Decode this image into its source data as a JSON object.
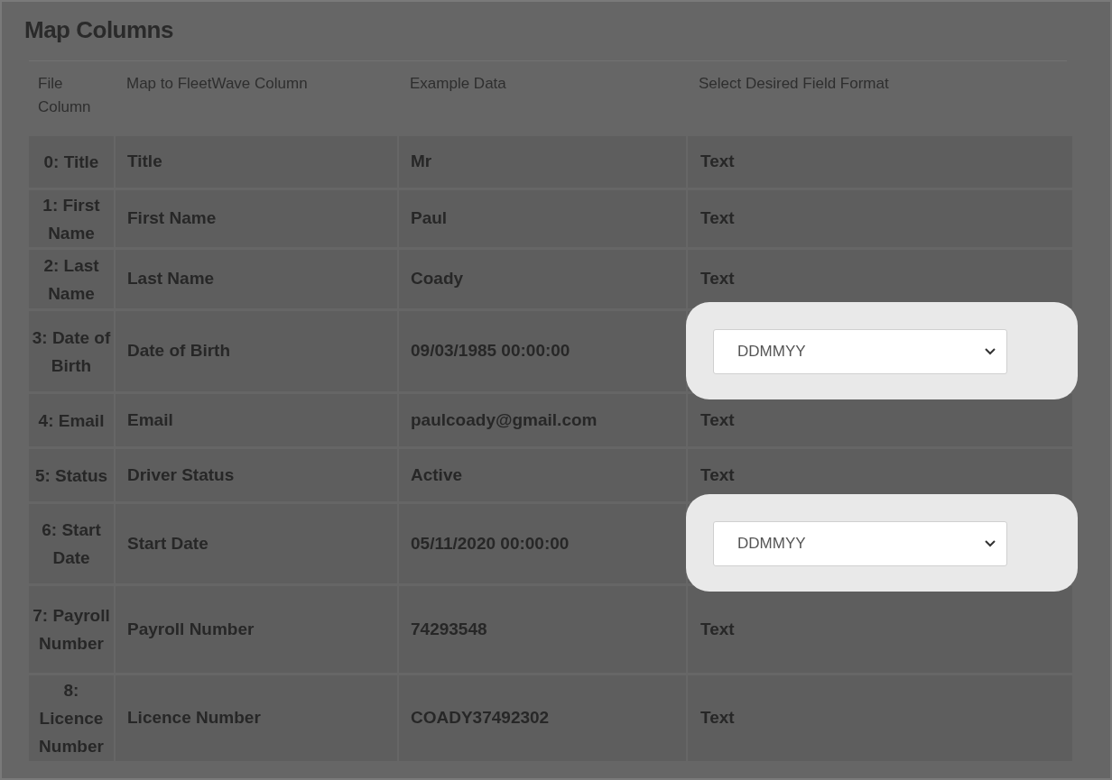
{
  "title": "Map Columns",
  "table": {
    "columns": [
      "File Column",
      "Map to FleetWave Column",
      "Example Data",
      "Select Desired Field Format"
    ],
    "rows": [
      {
        "file_column": "0: Title",
        "fleetwave_column": "Title",
        "example": "Mr",
        "format": {
          "kind": "text",
          "value": "Text"
        }
      },
      {
        "file_column": "1: First Name",
        "fleetwave_column": "First Name",
        "example": "Paul",
        "format": {
          "kind": "text",
          "value": "Text"
        }
      },
      {
        "file_column": "2: Last Name",
        "fleetwave_column": "Last Name",
        "example": "Coady",
        "format": {
          "kind": "text",
          "value": "Text"
        }
      },
      {
        "file_column": "3: Date of Birth",
        "fleetwave_column": "Date of Birth",
        "example": "09/03/1985 00:00:00",
        "format": {
          "kind": "select",
          "value": "DDMMYY",
          "highlighted": true
        }
      },
      {
        "file_column": "4: Email",
        "fleetwave_column": "Email",
        "example": "paulcoady@gmail.com",
        "format": {
          "kind": "text",
          "value": "Text"
        }
      },
      {
        "file_column": "5: Status",
        "fleetwave_column": "Driver Status",
        "example": "Active",
        "format": {
          "kind": "text",
          "value": "Text"
        }
      },
      {
        "file_column": "6: Start Date",
        "fleetwave_column": "Start Date",
        "example": "05/11/2020 00:00:00",
        "format": {
          "kind": "select",
          "value": "DDMMYY",
          "highlighted": true
        }
      },
      {
        "file_column": "7: Payroll Number",
        "fleetwave_column": "Payroll Number",
        "example": "74293548",
        "format": {
          "kind": "text",
          "value": "Text"
        }
      },
      {
        "file_column": "8: Licence Number",
        "fleetwave_column": "Licence Number",
        "example": "COADY37492302",
        "format": {
          "kind": "text",
          "value": "Text"
        }
      }
    ]
  }
}
